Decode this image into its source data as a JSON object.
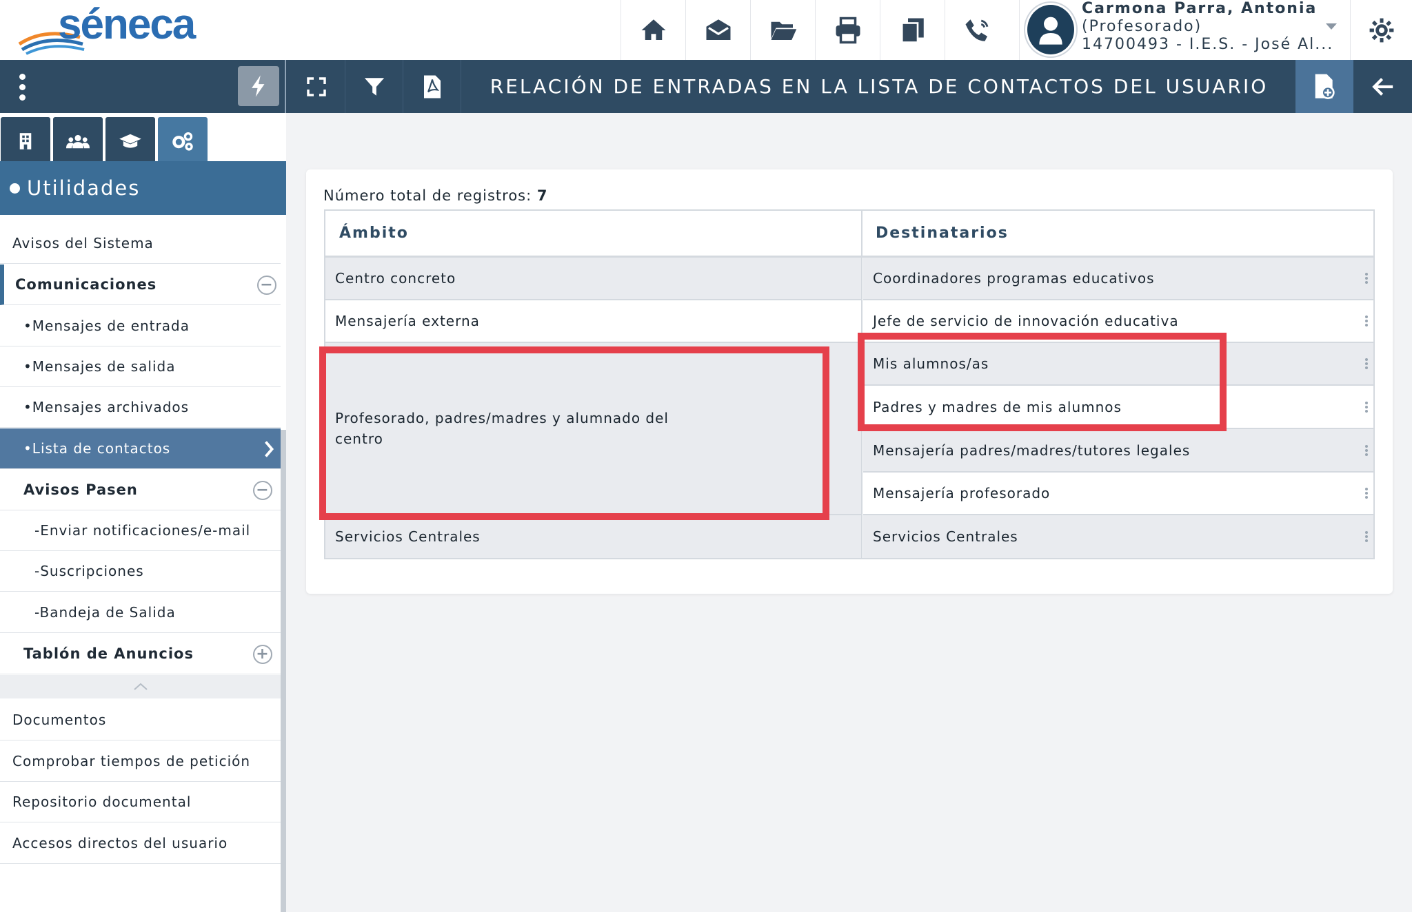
{
  "app": {
    "logo_text": "séneca",
    "colors": {
      "brand_dark": "#2f4b63",
      "accent": "#3b6d96",
      "highlight": "#e5404b"
    }
  },
  "toolbar": {
    "icons": [
      "home-icon",
      "envelope-icon",
      "folder-open-icon",
      "print-icon",
      "copy-icon",
      "phone-icon"
    ]
  },
  "user": {
    "name": "Carmona Parra, Antonia",
    "role": "(Profesorado)",
    "center": "14700493 - I.E.S. - José Al..."
  },
  "nav": {
    "title": "RELACIÓN DE ENTRADAS EN LA LISTA DE CONTACTOS DEL USUARIO"
  },
  "sidebar": {
    "section_title": "Utilidades",
    "items": {
      "avisos_sistema": "Avisos del Sistema",
      "comunicaciones": "Comunicaciones",
      "mensajes_entrada": "•Mensajes de entrada",
      "mensajes_salida": "•Mensajes de salida",
      "mensajes_archivados": "•Mensajes archivados",
      "lista_contactos": "•Lista de contactos",
      "avisos_pasen": "Avisos Pasen",
      "enviar_notificaciones": "-Enviar notificaciones/e-mail",
      "suscripciones": "-Suscripciones",
      "bandeja_salida": "-Bandeja de Salida",
      "tablon_anuncios": "Tablón de Anuncios",
      "documentos": "Documentos",
      "comprobar_tiempos": "Comprobar tiempos de petición",
      "repositorio": "Repositorio documental",
      "accesos_directos": "Accesos directos del usuario"
    }
  },
  "content": {
    "record_label": "Número total de registros:",
    "record_count": "7",
    "columns": {
      "ambito": "Ámbito",
      "destinatarios": "Destinatarios"
    },
    "ambito": {
      "centro_concreto": "Centro concreto",
      "mensajeria_externa": "Mensajería externa",
      "profesorado_line1": "Profesorado, padres/madres y alumnado del",
      "profesorado_line2": "centro",
      "servicios_centrales": "Servicios Centrales"
    },
    "destinatarios": [
      "Coordinadores programas educativos",
      "Jefe de servicio de innovación educativa",
      "Mis alumnos/as",
      "Padres y madres de mis alumnos",
      "Mensajería padres/madres/tutores legales",
      "Mensajería profesorado",
      "Servicios Centrales"
    ]
  }
}
